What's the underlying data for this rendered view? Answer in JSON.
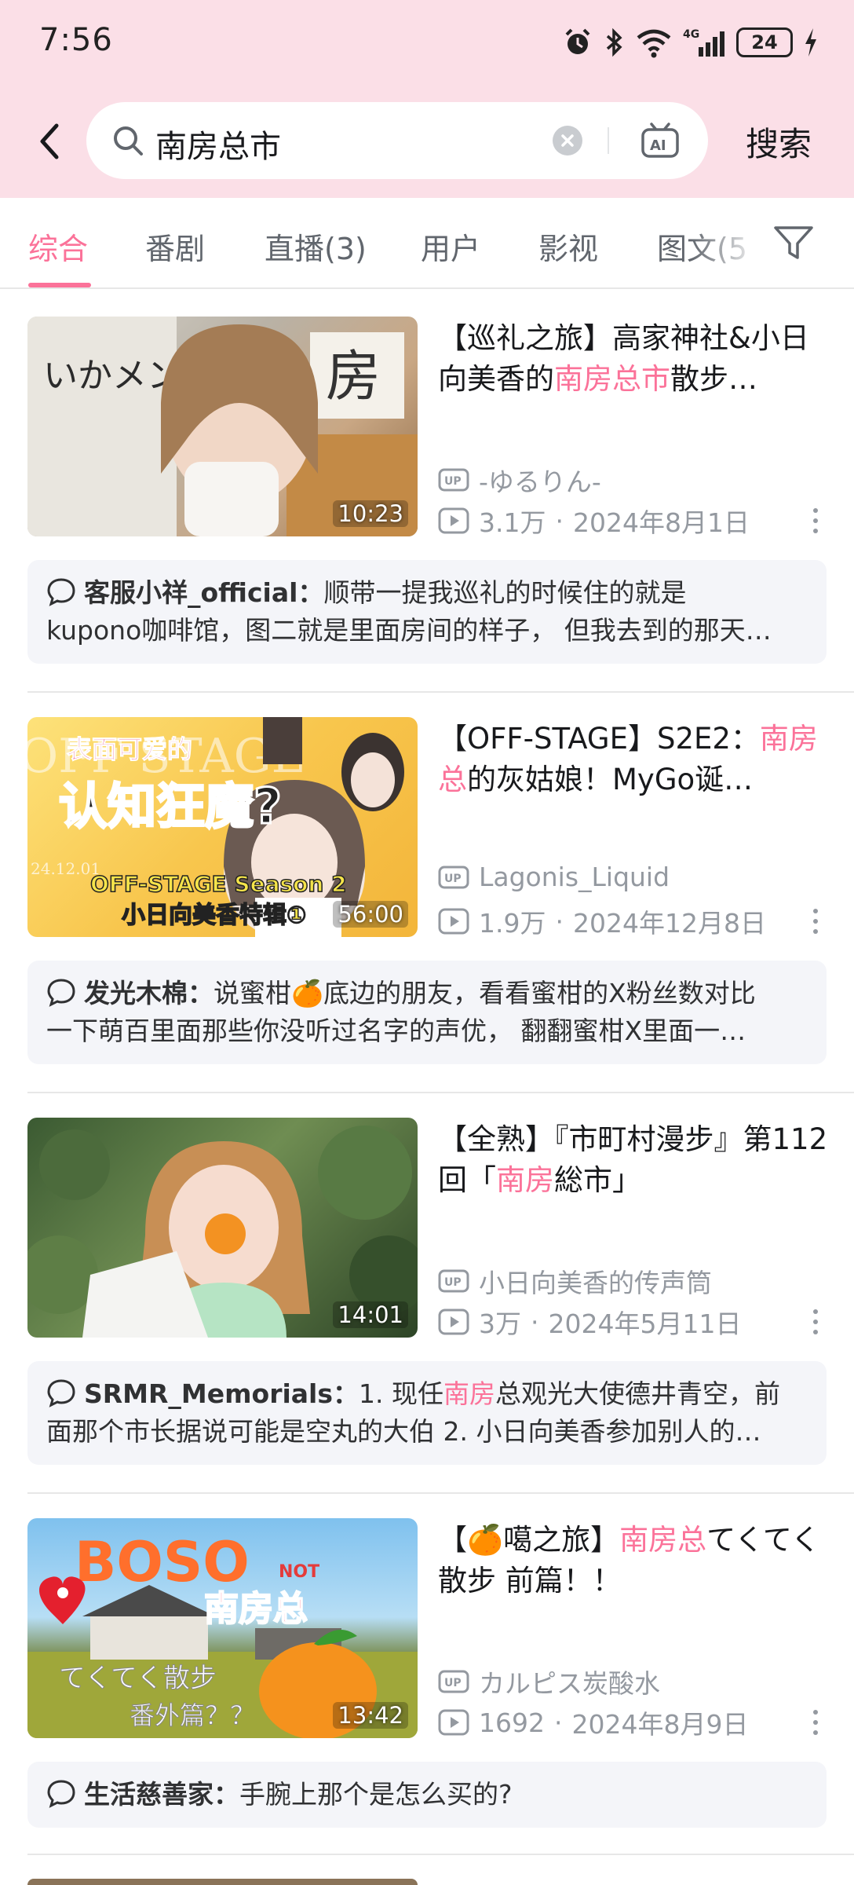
{
  "status_bar": {
    "time": "7:56",
    "battery": "24",
    "network": "4G"
  },
  "search": {
    "query": "南房总市",
    "submit_label": "搜索"
  },
  "tabs": [
    {
      "label": "综合",
      "active": true
    },
    {
      "label": "番剧"
    },
    {
      "label": "直播(3)"
    },
    {
      "label": "用户"
    },
    {
      "label": "影视"
    },
    {
      "label": "图文(5"
    }
  ],
  "colors": {
    "accent": "#fb7299",
    "header_bg": "#fbdfe7",
    "comment_bg": "#f4f5f9"
  },
  "results": [
    {
      "duration": "10:23",
      "title_pre": "【巡礼之旅】高家神社&小日向美香的",
      "title_hl": "南房总市",
      "title_post": "散步…",
      "uploader": "-ゆるりん-",
      "views": "3.1万",
      "date": "2024年8月1日",
      "comment_user": "客服小祥_official：",
      "comment_line1": "顺带一提我巡礼的时候住的就是",
      "comment_line2": "kupono咖啡馆，图二就是里面房间的样子， 但我去到的那天…"
    },
    {
      "duration": "56:00",
      "title_pre": "【OFF-STAGE】S2E2：",
      "title_hl": "南房总",
      "title_post": "的灰姑娘！MyGo诞…",
      "uploader": "Lagonis_Liquid",
      "views": "1.9万",
      "date": "2024年12月8日",
      "comment_user": "发光木棉：",
      "comment_line1": "说蜜柑🍊底边的朋友，看看蜜柑的X粉丝数对比",
      "comment_line2": "一下萌百里面那些你没听过名字的声优， 翻翻蜜柑X里面一…"
    },
    {
      "duration": "14:01",
      "title_pre": "【全熟】『市町村漫步』第112回「",
      "title_hl": "南房",
      "title_post": "総市」",
      "uploader": "小日向美香的传声筒",
      "views": "3万",
      "date": "2024年5月11日",
      "comment_user": "SRMR_Memorials：",
      "comment_line1_pre": "1. 现任",
      "comment_line1_hl": "南房",
      "comment_line1_post": "总观光大使德井青空，前",
      "comment_line2": "面那个市长据说可能是空丸的大伯 2. 小日向美香参加别人的…"
    },
    {
      "duration": "13:42",
      "title_pre": "【🍊噶之旅】",
      "title_hl": "南房总",
      "title_post": "てくてく散步 前篇！！",
      "uploader": "カルピス炭酸水",
      "views": "1692",
      "date": "2024年8月9日",
      "comment_user": "生活慈善家：",
      "comment_line1": "手腕上那个是怎么买的?"
    }
  ],
  "thumb_text": {
    "r1_sign": "房",
    "r2_caption1": "表面可爱的",
    "r2_caption2": "认知狂魔?",
    "r2_caption3": "OFF-STAGE Season 2",
    "r2_caption4": "小日向美香特辑①",
    "r2_bg": "OFF STAGE",
    "r2_date": "24.12.01",
    "r4_boso": "BOSO",
    "r4_not": "NOT",
    "r4_place": "南房总",
    "r4_walk": "てくてく散步",
    "r4_extra": "番外篇？？"
  }
}
